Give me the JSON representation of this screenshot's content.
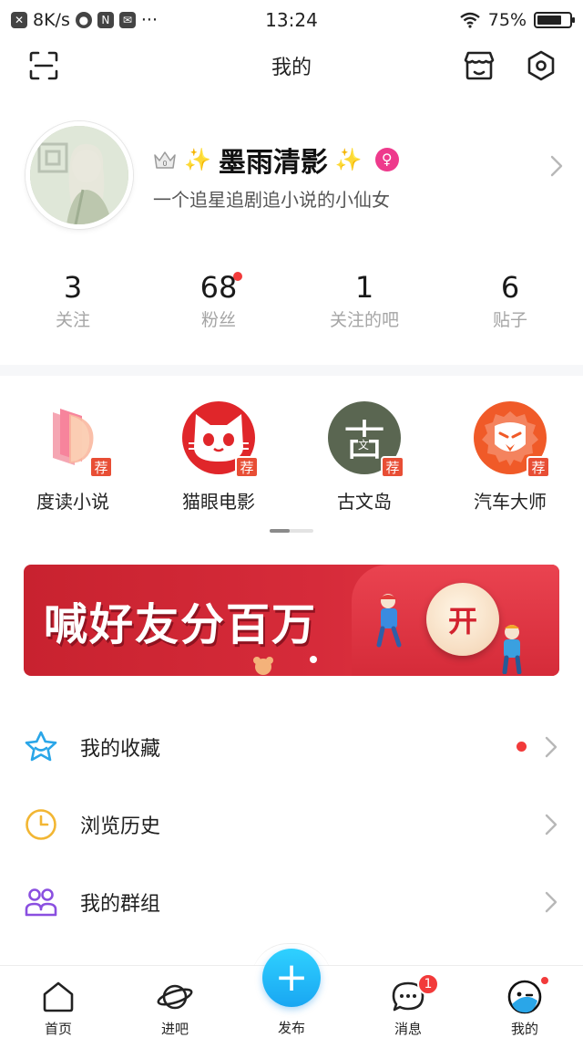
{
  "status_bar": {
    "speed": "8K/s",
    "time": "13:24",
    "battery": "75%",
    "battery_level": 0.75,
    "icons": [
      "notification-x-icon",
      "planet-icon",
      "nfc-icon",
      "mail-icon",
      "more-dots-icon",
      "wifi-icon",
      "battery-icon"
    ]
  },
  "header": {
    "title": "我的",
    "left_icon": "scan-icon",
    "right_icons": [
      "shop-icon",
      "settings-icon"
    ]
  },
  "profile": {
    "username": "墨雨清影",
    "bio": "一个追星追剧追小说的小仙女",
    "level": "0",
    "sparkle": "✨",
    "gender_icon": "female-icon",
    "avatar_icon": "avatar-image"
  },
  "stats": [
    {
      "value": "3",
      "label": "关注",
      "dot": false
    },
    {
      "value": "68",
      "label": "粉丝",
      "dot": true
    },
    {
      "value": "1",
      "label": "关注的吧",
      "dot": false
    },
    {
      "value": "6",
      "label": "贴子",
      "dot": false
    }
  ],
  "apps": [
    {
      "label": "度读小说",
      "badge": "荐",
      "icon": "duread-book-icon"
    },
    {
      "label": "猫眼电影",
      "badge": "荐",
      "icon": "maoyan-cat-icon"
    },
    {
      "label": "古文岛",
      "badge": "荐",
      "icon": "guwendao-icon",
      "glyph": "古",
      "glyph_small": "文"
    },
    {
      "label": "汽车大师",
      "badge": "荐",
      "icon": "lion-icon"
    }
  ],
  "banner": {
    "text": "喊好友分百万",
    "button": "开"
  },
  "menu": [
    {
      "label": "我的收藏",
      "icon": "star-icon",
      "color": "#2aa6e8",
      "dot": true
    },
    {
      "label": "浏览历史",
      "icon": "clock-icon",
      "color": "#f2b633",
      "dot": false
    },
    {
      "label": "我的群组",
      "icon": "group-icon",
      "color": "#8a4fe0",
      "dot": false
    }
  ],
  "bottom_nav": {
    "home": "首页",
    "enter": "进吧",
    "publish": "发布",
    "publish_symbol": "+",
    "messages": "消息",
    "messages_badge": "1",
    "mine": "我的"
  },
  "colors": {
    "accent_blue": "#19a6f2",
    "badge_red": "#f23a3a",
    "banner_red": "#d62b3a"
  }
}
